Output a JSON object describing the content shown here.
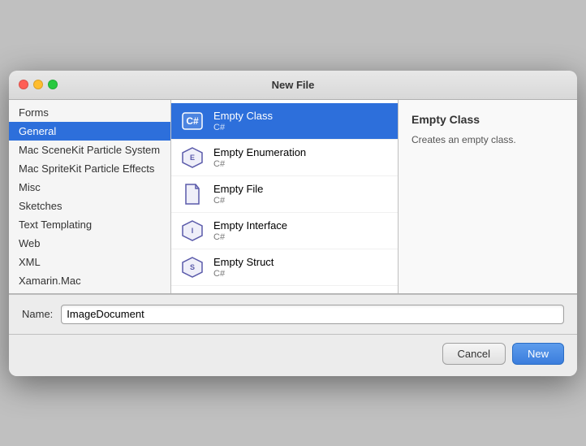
{
  "window": {
    "title": "New File"
  },
  "sidebar": {
    "items": [
      {
        "id": "forms",
        "label": "Forms"
      },
      {
        "id": "general",
        "label": "General",
        "selected": true
      },
      {
        "id": "mac-scenekit",
        "label": "Mac SceneKit Particle System"
      },
      {
        "id": "mac-spritekit",
        "label": "Mac SpriteKit Particle Effects"
      },
      {
        "id": "misc",
        "label": "Misc"
      },
      {
        "id": "sketches",
        "label": "Sketches"
      },
      {
        "id": "text-templating",
        "label": "Text Templating"
      },
      {
        "id": "web",
        "label": "Web"
      },
      {
        "id": "xml",
        "label": "XML"
      },
      {
        "id": "xamarin-mac",
        "label": "Xamarin.Mac"
      }
    ]
  },
  "file_list": {
    "items": [
      {
        "id": "empty-class",
        "title": "Empty Class",
        "subtitle": "C#",
        "selected": true,
        "icon": "class"
      },
      {
        "id": "empty-enumeration",
        "title": "Empty Enumeration",
        "subtitle": "C#",
        "selected": false,
        "icon": "enum"
      },
      {
        "id": "empty-file",
        "title": "Empty File",
        "subtitle": "C#",
        "selected": false,
        "icon": "file"
      },
      {
        "id": "empty-interface",
        "title": "Empty Interface",
        "subtitle": "C#",
        "selected": false,
        "icon": "interface"
      },
      {
        "id": "empty-struct",
        "title": "Empty Struct",
        "subtitle": "C#",
        "selected": false,
        "icon": "struct"
      }
    ]
  },
  "detail": {
    "title": "Empty Class",
    "description": "Creates an empty class."
  },
  "bottom": {
    "name_label": "Name:",
    "name_value": "ImageDocument"
  },
  "buttons": {
    "cancel_label": "Cancel",
    "new_label": "New"
  }
}
